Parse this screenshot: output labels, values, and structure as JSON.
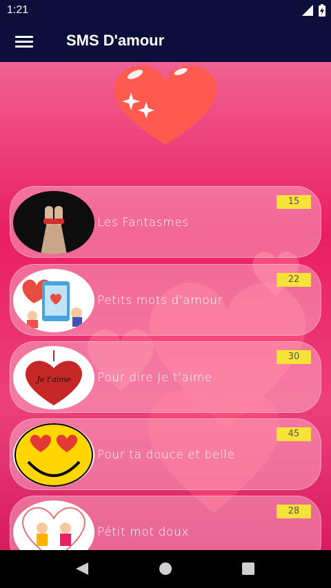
{
  "status_bar": {
    "time": "1:21"
  },
  "app_bar": {
    "title": "SMS D'amour"
  },
  "colors": {
    "app_bar": "#0b0f3a",
    "background": "#e91e63",
    "badge": "#f7e23a",
    "card": "#ffcddc"
  },
  "categories": [
    {
      "label": "Les Fantasmes",
      "count": "15",
      "icon": "tied-hands-image"
    },
    {
      "label": "Petits mots d'amour",
      "count": "22",
      "icon": "phone-hearts-image"
    },
    {
      "label": "Pour dire Je t'aime",
      "count": "30",
      "icon": "je-taime-heart-image"
    },
    {
      "label": "Pour ta douce et belle",
      "count": "45",
      "icon": "heart-eyes-emoji-image"
    },
    {
      "label": "Pétit mot doux",
      "count": "28",
      "icon": "couple-image"
    }
  ]
}
